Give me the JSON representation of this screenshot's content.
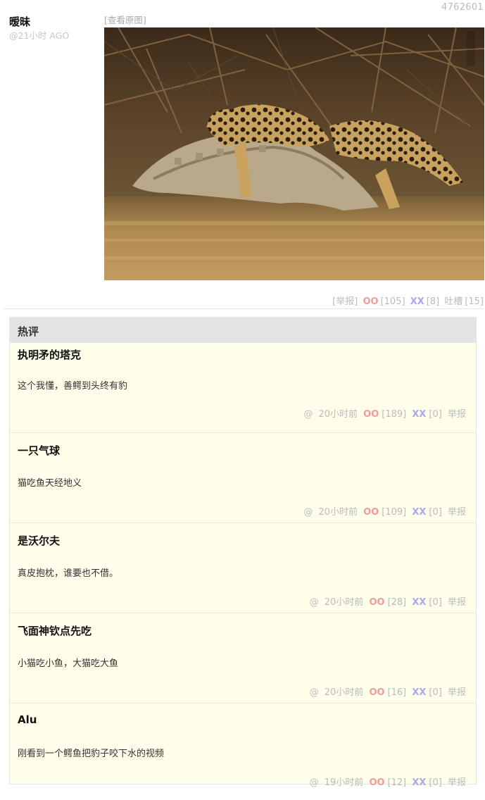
{
  "post": {
    "id": "4762601",
    "author": "暧昧",
    "time": "@21小时 AGO",
    "view_original": "[查看原图]",
    "report": "[举报]",
    "oo_label": "OO",
    "oo_count": "[105]",
    "xx_label": "XX",
    "xx_count": "[8]",
    "tucao_label": "吐槽",
    "tucao_count": "[15]"
  },
  "hot": {
    "title": "热评",
    "comments": [
      {
        "author": "执明矛的塔克",
        "text": "这个我懂，善鳄到头终有豹",
        "at": "@",
        "time": "20小时前",
        "oo": "OO",
        "oo_count": "[189]",
        "xx": "XX",
        "xx_count": "[0]",
        "report": "举报"
      },
      {
        "author": "一只气球",
        "text": "猫吃鱼天经地义",
        "at": "@",
        "time": "20小时前",
        "oo": "OO",
        "oo_count": "[109]",
        "xx": "XX",
        "xx_count": "[0]",
        "report": "举报"
      },
      {
        "author": "是沃尔夫",
        "text": "真皮抱枕，谁要也不借。",
        "at": "@",
        "time": "20小时前",
        "oo": "OO",
        "oo_count": "[28]",
        "xx": "XX",
        "xx_count": "[0]",
        "report": "举报"
      },
      {
        "author": "飞面神钦点先吃",
        "text": "小猫吃小鱼，大猫吃大鱼",
        "at": "@",
        "time": "20小时前",
        "oo": "OO",
        "oo_count": "[16]",
        "xx": "XX",
        "xx_count": "[0]",
        "report": "举报"
      },
      {
        "author": "Alu",
        "text": "刚看到一个鳄鱼把豹子咬下水的视频",
        "at": "@",
        "time": "19小时前",
        "oo": "OO",
        "oo_count": "[12]",
        "xx": "XX",
        "xx_count": "[0]",
        "report": "举报"
      }
    ]
  },
  "colors": {
    "oo": "#f29a9a",
    "xx": "#a9a9f2",
    "hot_bg": "#fefeea",
    "hot_head_bg": "#e4e4e4"
  }
}
